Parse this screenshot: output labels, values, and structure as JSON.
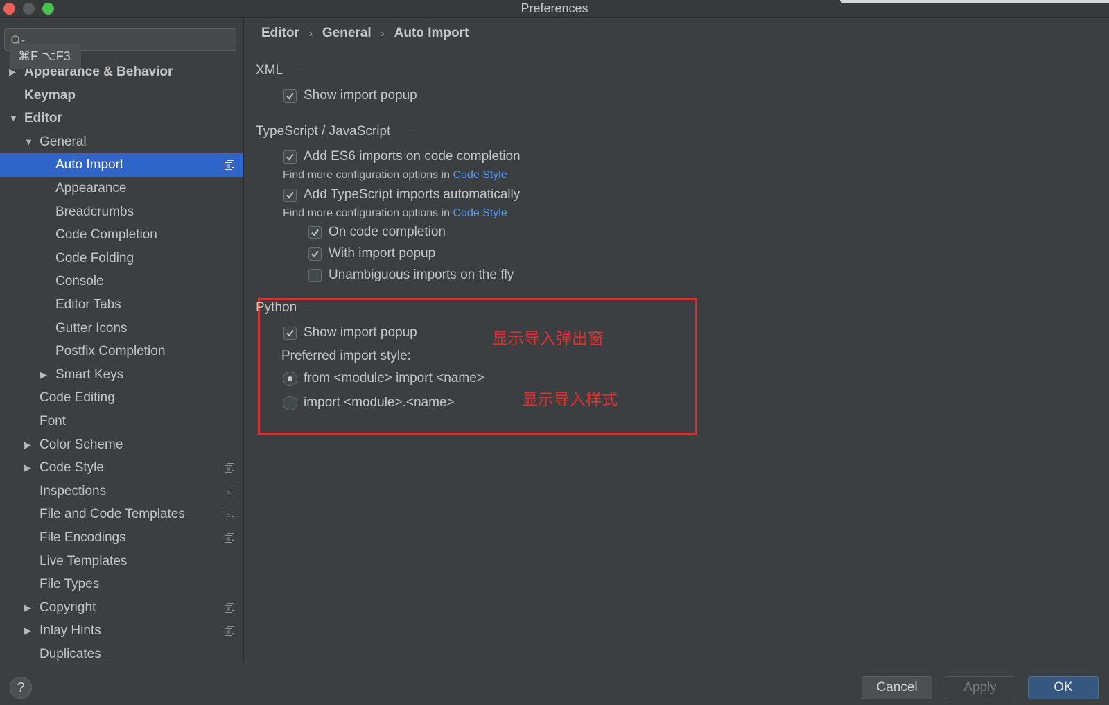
{
  "window": {
    "title": "Preferences"
  },
  "search": {
    "placeholder": "",
    "shortcut_tip": "⌘F ⌥F3"
  },
  "sidebar": {
    "items": [
      {
        "label": "Appearance & Behavior",
        "level": 0,
        "arrow": "▶",
        "bold": true
      },
      {
        "label": "Keymap",
        "level": 0,
        "arrow": "",
        "bold": true
      },
      {
        "label": "Editor",
        "level": 0,
        "arrow": "▼",
        "bold": true
      },
      {
        "label": "General",
        "level": 1,
        "arrow": "▼"
      },
      {
        "label": "Auto Import",
        "level": 2,
        "arrow": "",
        "selected": true,
        "project_icon": true
      },
      {
        "label": "Appearance",
        "level": 2,
        "arrow": ""
      },
      {
        "label": "Breadcrumbs",
        "level": 2,
        "arrow": ""
      },
      {
        "label": "Code Completion",
        "level": 2,
        "arrow": ""
      },
      {
        "label": "Code Folding",
        "level": 2,
        "arrow": ""
      },
      {
        "label": "Console",
        "level": 2,
        "arrow": ""
      },
      {
        "label": "Editor Tabs",
        "level": 2,
        "arrow": ""
      },
      {
        "label": "Gutter Icons",
        "level": 2,
        "arrow": ""
      },
      {
        "label": "Postfix Completion",
        "level": 2,
        "arrow": ""
      },
      {
        "label": "Smart Keys",
        "level": 2,
        "arrow": "▶"
      },
      {
        "label": "Code Editing",
        "level": 1,
        "arrow": ""
      },
      {
        "label": "Font",
        "level": 1,
        "arrow": ""
      },
      {
        "label": "Color Scheme",
        "level": 1,
        "arrow": "▶"
      },
      {
        "label": "Code Style",
        "level": 1,
        "arrow": "▶",
        "project_icon": true
      },
      {
        "label": "Inspections",
        "level": 1,
        "arrow": "",
        "project_icon": true
      },
      {
        "label": "File and Code Templates",
        "level": 1,
        "arrow": "",
        "project_icon": true
      },
      {
        "label": "File Encodings",
        "level": 1,
        "arrow": "",
        "project_icon": true
      },
      {
        "label": "Live Templates",
        "level": 1,
        "arrow": ""
      },
      {
        "label": "File Types",
        "level": 1,
        "arrow": ""
      },
      {
        "label": "Copyright",
        "level": 1,
        "arrow": "▶",
        "project_icon": true
      },
      {
        "label": "Inlay Hints",
        "level": 1,
        "arrow": "▶",
        "project_icon": true
      },
      {
        "label": "Duplicates",
        "level": 1,
        "arrow": ""
      }
    ]
  },
  "breadcrumb": {
    "items": [
      "Editor",
      "General",
      "Auto Import"
    ],
    "separator": "›"
  },
  "xml": {
    "title": "XML",
    "show_import_popup": {
      "label": "Show import popup",
      "checked": true
    }
  },
  "ts": {
    "title": "TypeScript / JavaScript",
    "es6": {
      "label": "Add ES6 imports on code completion",
      "checked": true
    },
    "hint_text": "Find more configuration options in",
    "hint_link": "Code Style",
    "ts_auto": {
      "label": "Add TypeScript imports automatically",
      "checked": true
    },
    "on_completion": {
      "label": "On code completion",
      "checked": true
    },
    "with_popup": {
      "label": "With import popup",
      "checked": true
    },
    "unambiguous": {
      "label": "Unambiguous imports on the fly",
      "checked": false
    }
  },
  "python": {
    "title": "Python",
    "show_import_popup": {
      "label": "Show import popup",
      "checked": true
    },
    "preferred_style_label": "Preferred import style:",
    "style_from": {
      "label": "from <module> import <name>",
      "selected": true
    },
    "style_import": {
      "label": "import <module>.<name>",
      "selected": false
    }
  },
  "annotations": {
    "popup": "显示导入弹出窗",
    "style": "显示导入样式",
    "color": "#e03131"
  },
  "buttons": {
    "help": "?",
    "cancel": "Cancel",
    "apply": "Apply",
    "ok": "OK"
  },
  "colors": {
    "selection": "#2f65ca",
    "link": "#589df6",
    "highlight_box": "#d63031"
  }
}
